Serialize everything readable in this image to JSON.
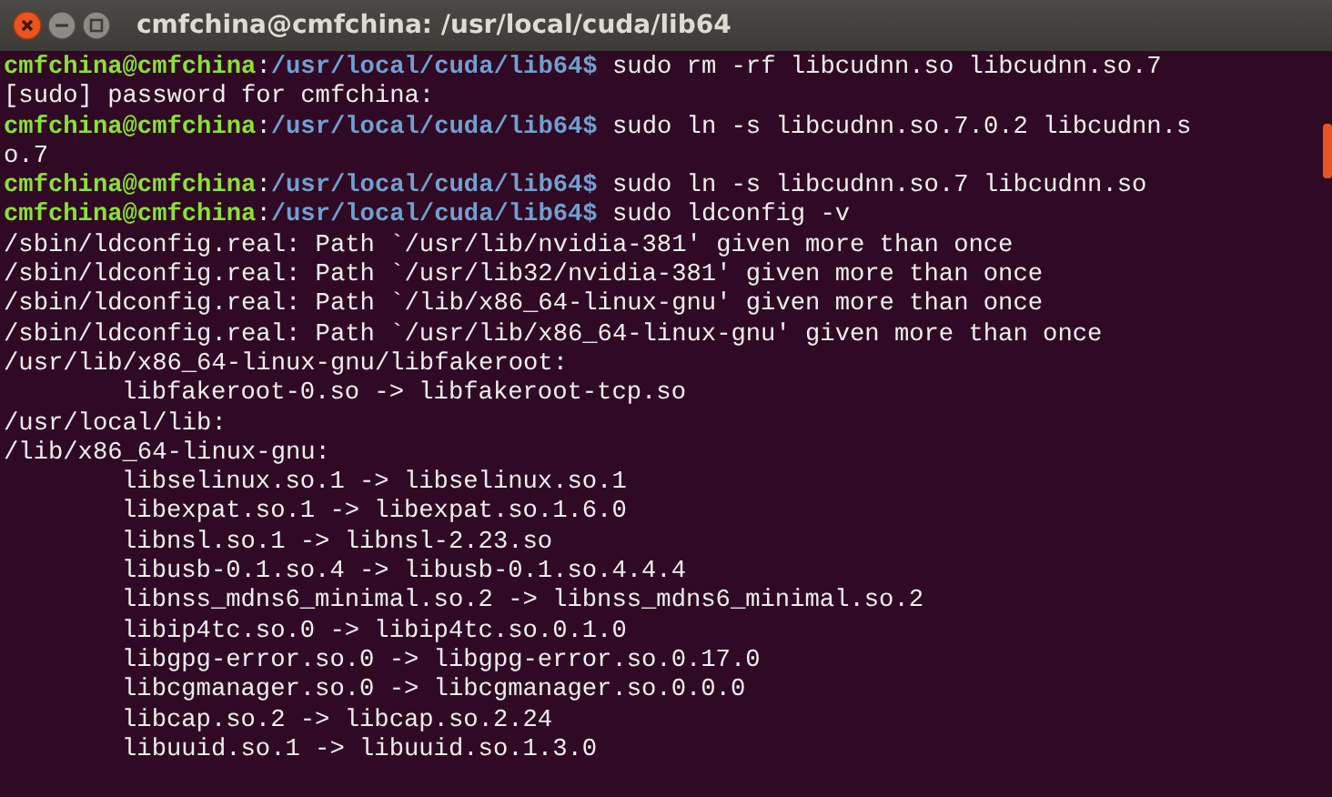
{
  "window": {
    "title": "cmfchina@cmfchina: /usr/local/cuda/lib64"
  },
  "lines": [
    {
      "kind": "prompt",
      "user": "cmfchina@cmfchina",
      "separator": ":",
      "path": "/usr/local/cuda/lib64$",
      "command": "sudo rm -rf libcudnn.so libcudnn.so.7"
    },
    {
      "kind": "output",
      "text": "[sudo] password for cmfchina:"
    },
    {
      "kind": "prompt",
      "user": "cmfchina@cmfchina",
      "separator": ":",
      "path": "/usr/local/cuda/lib64$",
      "command": "sudo ln -s libcudnn.so.7.0.2 libcudnn.s"
    },
    {
      "kind": "output",
      "text": "o.7"
    },
    {
      "kind": "prompt",
      "user": "cmfchina@cmfchina",
      "separator": ":",
      "path": "/usr/local/cuda/lib64$",
      "command": "sudo ln -s libcudnn.so.7 libcudnn.so"
    },
    {
      "kind": "prompt",
      "user": "cmfchina@cmfchina",
      "separator": ":",
      "path": "/usr/local/cuda/lib64$",
      "command": "sudo ldconfig -v"
    },
    {
      "kind": "output",
      "text": "/sbin/ldconfig.real: Path `/usr/lib/nvidia-381' given more than once"
    },
    {
      "kind": "output",
      "text": "/sbin/ldconfig.real: Path `/usr/lib32/nvidia-381' given more than once"
    },
    {
      "kind": "output",
      "text": "/sbin/ldconfig.real: Path `/lib/x86_64-linux-gnu' given more than once"
    },
    {
      "kind": "output",
      "text": "/sbin/ldconfig.real: Path `/usr/lib/x86_64-linux-gnu' given more than once"
    },
    {
      "kind": "output",
      "text": "/usr/lib/x86_64-linux-gnu/libfakeroot:"
    },
    {
      "kind": "indented",
      "text": "libfakeroot-0.so -> libfakeroot-tcp.so"
    },
    {
      "kind": "output",
      "text": "/usr/local/lib:"
    },
    {
      "kind": "output",
      "text": "/lib/x86_64-linux-gnu:"
    },
    {
      "kind": "indented",
      "text": "libselinux.so.1 -> libselinux.so.1"
    },
    {
      "kind": "indented",
      "text": "libexpat.so.1 -> libexpat.so.1.6.0"
    },
    {
      "kind": "indented",
      "text": "libnsl.so.1 -> libnsl-2.23.so"
    },
    {
      "kind": "indented",
      "text": "libusb-0.1.so.4 -> libusb-0.1.so.4.4.4"
    },
    {
      "kind": "indented",
      "text": "libnss_mdns6_minimal.so.2 -> libnss_mdns6_minimal.so.2"
    },
    {
      "kind": "indented",
      "text": "libip4tc.so.0 -> libip4tc.so.0.1.0"
    },
    {
      "kind": "indented",
      "text": "libgpg-error.so.0 -> libgpg-error.so.0.17.0"
    },
    {
      "kind": "indented",
      "text": "libcgmanager.so.0 -> libcgmanager.so.0.0.0"
    },
    {
      "kind": "indented",
      "text": "libcap.so.2 -> libcap.so.2.24"
    },
    {
      "kind": "indented",
      "text": "libuuid.so.1 -> libuuid.so.1.3.0"
    }
  ]
}
